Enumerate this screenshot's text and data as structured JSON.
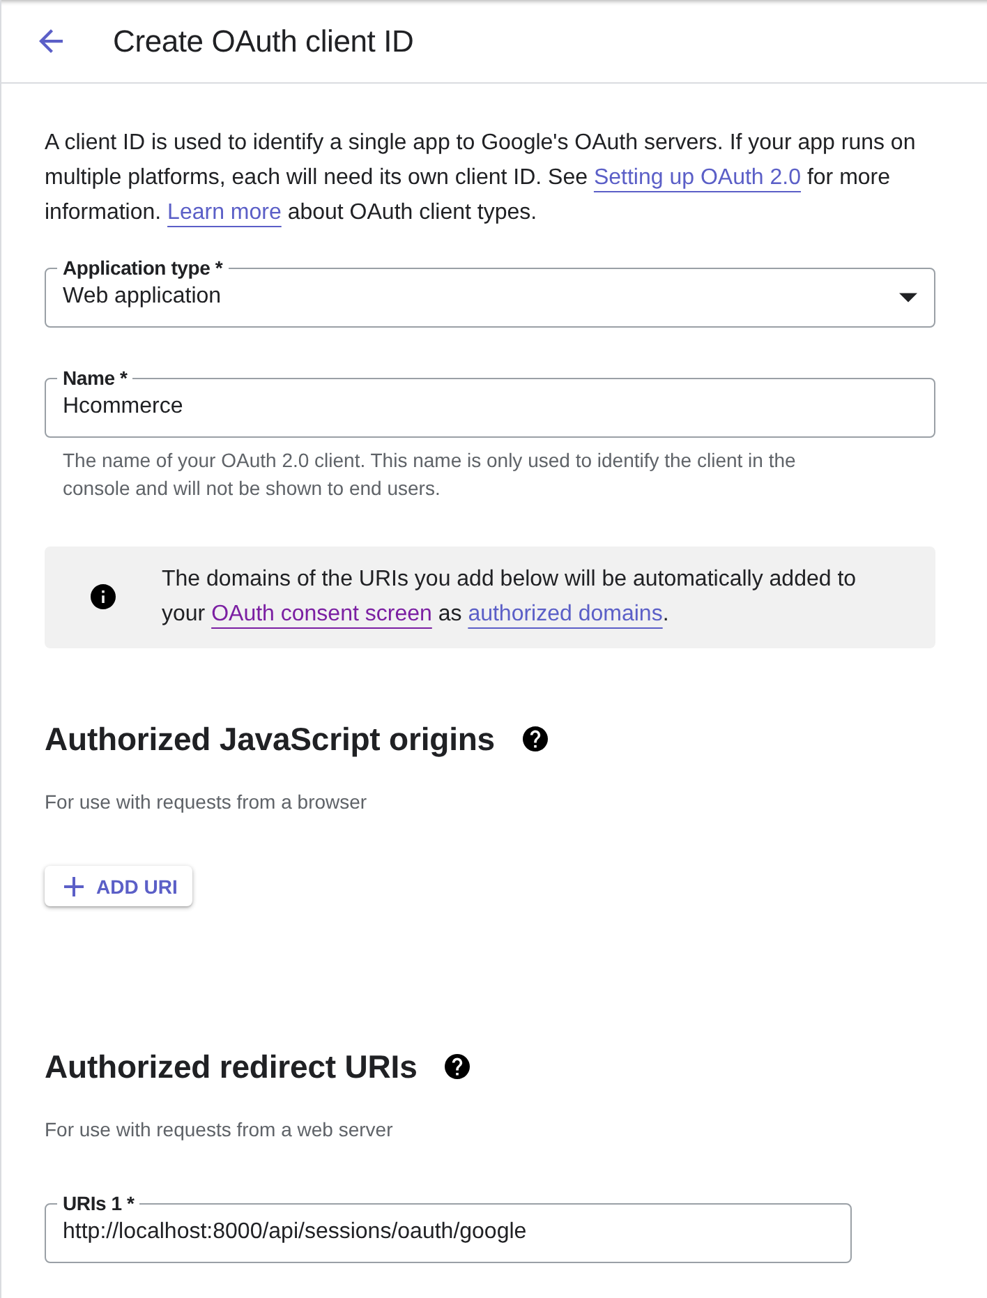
{
  "header": {
    "title": "Create OAuth client ID"
  },
  "intro": [
    {
      "kind": "text",
      "text": "A client ID is used to identify a single app to Google's OAuth servers. If your app runs on multiple platforms, each will need its own client ID. See "
    },
    {
      "kind": "link",
      "text": "Setting up OAuth 2.0",
      "visited": false
    },
    {
      "kind": "text",
      "text": " for more information. "
    },
    {
      "kind": "link",
      "text": "Learn more",
      "visited": false
    },
    {
      "kind": "text",
      "text": " about OAuth client types."
    }
  ],
  "fields": [
    {
      "kind": "select",
      "label": "Application type *",
      "value": "Web application"
    },
    {
      "kind": "text",
      "label": "Name *",
      "value": "Hcommerce",
      "helper": "The name of your OAuth 2.0 client. This name is only used to identify the client in the console and will not be shown to end users."
    }
  ],
  "notice": [
    {
      "kind": "text",
      "text": "The domains of the URIs you add below will be automatically added to your "
    },
    {
      "kind": "link",
      "text": "OAuth consent screen",
      "visited": true
    },
    {
      "kind": "text",
      "text": " as "
    },
    {
      "kind": "link",
      "text": "authorized domains",
      "visited": false
    },
    {
      "kind": "text",
      "text": "."
    }
  ],
  "javascript_origins": {
    "title": "Authorized JavaScript origins",
    "subtitle": "For use with requests from a browser",
    "add_button": "ADD URI"
  },
  "redirect_uris": {
    "title": "Authorized redirect URIs",
    "subtitle": "For use with requests from a web server",
    "uris": [
      {
        "label": "URIs 1 *",
        "value": "http://localhost:8000/api/sessions/oauth/google"
      }
    ]
  }
}
